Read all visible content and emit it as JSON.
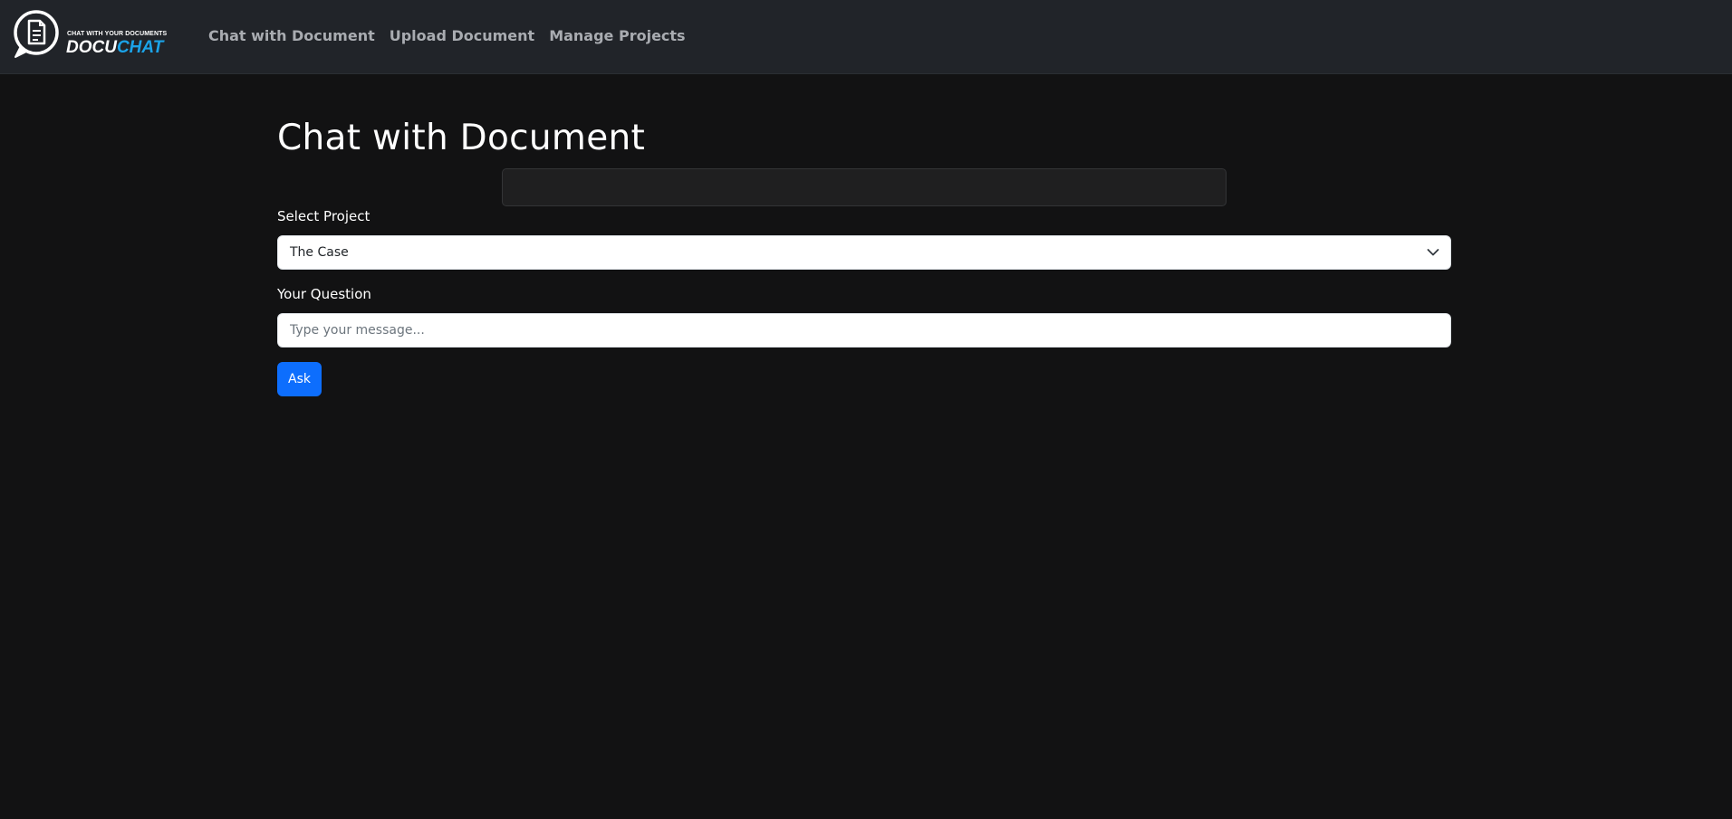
{
  "brand": {
    "tagline": "CHAT WITH YOUR DOCUMENTS",
    "wordmark_part1": "DOCU",
    "wordmark_part2": "CHAT",
    "icon": "document-chat-bubble-icon",
    "accent_color": "#1ba3e8"
  },
  "nav": {
    "items": [
      {
        "label": "Chat with Document"
      },
      {
        "label": "Upload Document"
      },
      {
        "label": "Manage Projects"
      }
    ]
  },
  "main": {
    "title": "Chat with Document",
    "response": "",
    "project_label": "Select Project",
    "project_selected": "The Case",
    "question_label": "Your Question",
    "question_value": "",
    "question_placeholder": "Type your message...",
    "ask_label": "Ask"
  },
  "colors": {
    "background": "#121213",
    "navbar": "#212429",
    "primary_button": "#0d6efd"
  }
}
